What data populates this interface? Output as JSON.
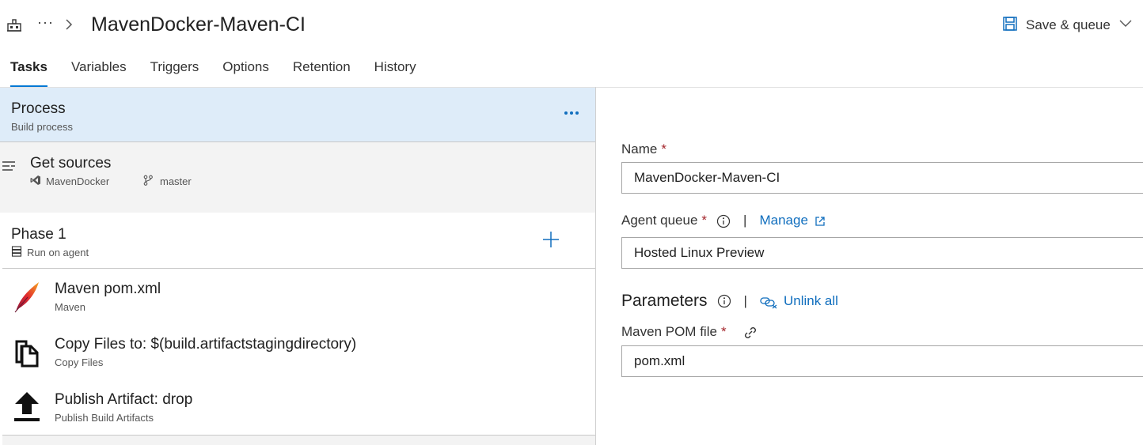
{
  "header": {
    "title": "MavenDocker-Maven-CI",
    "more": "···",
    "save_queue_label": "Save & queue"
  },
  "tabs": [
    {
      "label": "Tasks"
    },
    {
      "label": "Variables"
    },
    {
      "label": "Triggers"
    },
    {
      "label": "Options"
    },
    {
      "label": "Retention"
    },
    {
      "label": "History"
    }
  ],
  "process": {
    "title": "Process",
    "subtitle": "Build process"
  },
  "get_sources": {
    "title": "Get sources",
    "repository": "MavenDocker",
    "branch": "master"
  },
  "phase": {
    "title": "Phase 1",
    "subtitle": "Run on agent"
  },
  "tasks": [
    {
      "title": "Maven pom.xml",
      "subtitle": "Maven",
      "icon": "maven-feather-icon"
    },
    {
      "title": "Copy Files to: $(build.artifactstagingdirectory)",
      "subtitle": "Copy Files",
      "icon": "copy-files-icon"
    },
    {
      "title": "Publish Artifact: drop",
      "subtitle": "Publish Build Artifacts",
      "icon": "upload-arrow-icon"
    }
  ],
  "form": {
    "name_label": "Name",
    "name_value": "MavenDocker-Maven-CI",
    "agent_queue_label": "Agent queue",
    "manage_link": "Manage",
    "agent_queue_value": "Hosted Linux Preview",
    "parameters_title": "Parameters",
    "unlink_all": "Unlink all",
    "pom_label": "Maven POM file",
    "pom_value": "pom.xml",
    "required_marker": "*",
    "separator": "|"
  },
  "colors": {
    "accent": "#0078d4",
    "link": "#106ebe",
    "selected_bg": "#deecf9",
    "required": "#a4262c"
  }
}
